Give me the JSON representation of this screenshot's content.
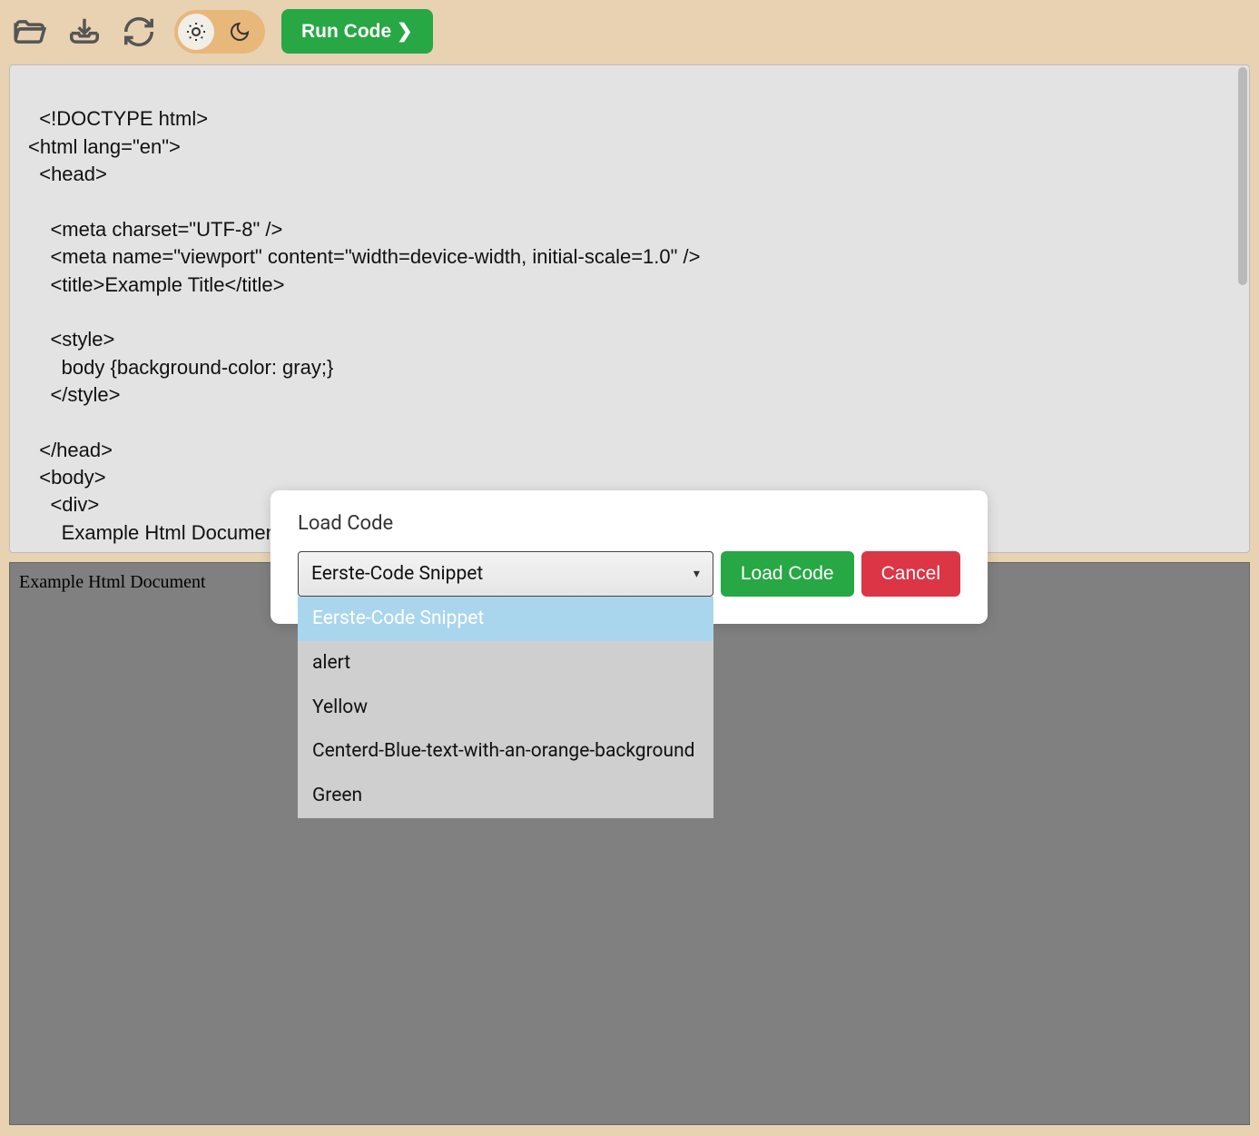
{
  "toolbar": {
    "run_label": "Run Code ❯"
  },
  "editor": {
    "code": "<!DOCTYPE html>\n<html lang=\"en\">\n  <head>\n\n    <meta charset=\"UTF-8\" />\n    <meta name=\"viewport\" content=\"width=device-width, initial-scale=1.0\" />\n    <title>Example Title</title>\n\n    <style>\n      body {background-color: gray;}\n    </style>\n\n  </head>\n  <body>\n    <div>\n      Example Html Document\n    </div>"
  },
  "preview": {
    "text": "Example Html Document"
  },
  "modal": {
    "title": "Load Code",
    "selected": "Eerste-Code Snippet",
    "options": [
      "Eerste-Code Snippet",
      "alert",
      "Yellow",
      "Centerd-Blue-text-with-an-orange-background",
      "Green"
    ],
    "load_label": "Load Code",
    "cancel_label": "Cancel"
  }
}
